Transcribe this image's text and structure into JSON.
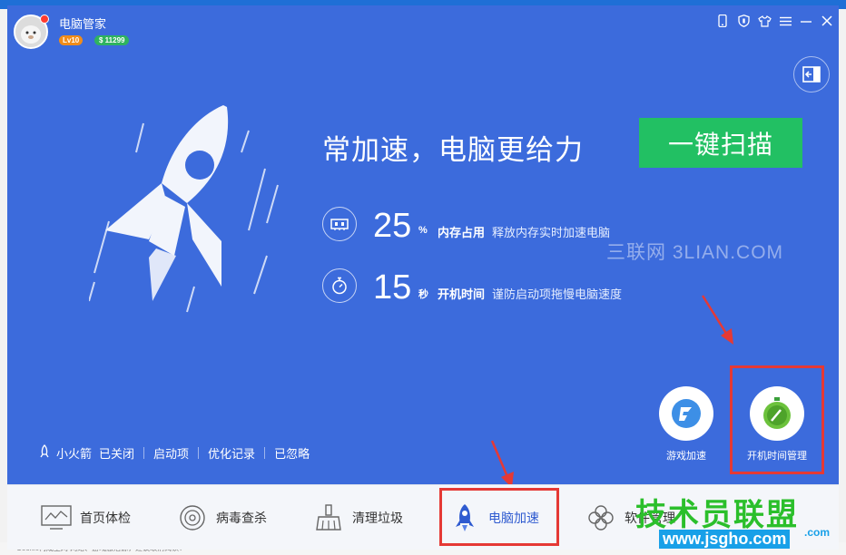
{
  "app": {
    "title": "电脑管家",
    "level": "Lv10",
    "coins": "$ 11299"
  },
  "titlebar_icons": [
    "phone-icon",
    "shield-icon",
    "shirt-icon",
    "menu-icon",
    "minimize-icon",
    "close-icon"
  ],
  "main": {
    "headline": "常加速，电脑更给力",
    "scan_button": "一键扫描",
    "memory": {
      "value": "25",
      "unit": "%",
      "label": "内存占用",
      "desc": "释放内存实时加速电脑"
    },
    "boot": {
      "value": "15",
      "unit": "秒",
      "label": "开机时间",
      "desc": "谨防启动项拖慢电脑速度"
    }
  },
  "watermark": "三联网 3LIAN.COM",
  "tools": [
    {
      "label": "游戏加速",
      "icon": "game-accel-icon"
    },
    {
      "label": "开机时间管理",
      "icon": "stopwatch-icon"
    }
  ],
  "statusbar": {
    "rocket_label": "小火箭",
    "rocket_state": "已关闭",
    "startup": "启动项",
    "history": "优化记录",
    "ignored": "已忽略"
  },
  "nav": [
    {
      "label": "首页体检",
      "icon": "monitor-icon"
    },
    {
      "label": "病毒查杀",
      "icon": "target-icon"
    },
    {
      "label": "清理垃圾",
      "icon": "broom-icon"
    },
    {
      "label": "电脑加速",
      "icon": "rocket-icon",
      "active": true
    },
    {
      "label": "软件管理",
      "icon": "clover-icon"
    }
  ],
  "overlay_logo": {
    "text": "技术员联盟",
    "url": "www.jsgho.com",
    "suffix": ".com"
  },
  "bottom_text": "Cookie构成主网   网络、游戏激活源，建议取消阅读！",
  "colors": {
    "window_bg": "#3c6bdc",
    "scan_button": "#22c063",
    "highlight": "#e53935",
    "nav_active": "#2f5bd0"
  }
}
